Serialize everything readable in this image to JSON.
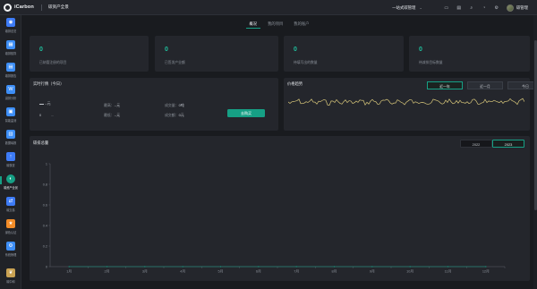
{
  "header": {
    "brand": "iCarbon",
    "section_title": "碳资产全景",
    "org_select": "一站式碳管理",
    "user_name": "碳管理",
    "icons": [
      "monitor-icon",
      "clipboard-icon",
      "search-icon",
      "bell-icon",
      "settings-icon"
    ]
  },
  "sidebar": {
    "items": [
      {
        "label": "碳排总览",
        "color": "#3d7bf6",
        "icon": "globe-icon"
      },
      {
        "label": "碳排核算",
        "color": "#3d8ef6",
        "icon": "calculator-icon"
      },
      {
        "label": "碳排报告",
        "color": "#3d8ef6",
        "icon": "report-icon"
      },
      {
        "label": "减排分析",
        "color": "#3d8ef6",
        "icon": "chart-icon"
      },
      {
        "label": "智能监测",
        "color": "#3d8ef6",
        "icon": "monitor-icon"
      },
      {
        "label": "数据填报",
        "color": "#3d8ef6",
        "icon": "form-icon"
      },
      {
        "label": "碳核查",
        "color": "#3d7bf6",
        "icon": "check-icon"
      },
      {
        "label": "碳资产全景",
        "color": "#16a085",
        "icon": "asset-icon"
      },
      {
        "label": "碳交易",
        "color": "#3d7bf6",
        "icon": "trade-icon"
      },
      {
        "label": "绿色认证",
        "color": "#f28c28",
        "icon": "certificate-icon"
      },
      {
        "label": "系统管理",
        "color": "#3d8ef6",
        "icon": "gear-icon"
      },
      {
        "label": "碳中和",
        "color": "#c9a253",
        "icon": "leaf-icon"
      }
    ]
  },
  "tabs": [
    {
      "label": "概况",
      "active": true
    },
    {
      "label": "我的项目",
      "active": false
    },
    {
      "label": "我的账户",
      "active": false
    }
  ],
  "stats": [
    {
      "value": "0",
      "label": "已纳管注册的项目"
    },
    {
      "value": "0",
      "label": "已签发产业额"
    },
    {
      "value": "0",
      "label": "待填写出的数量"
    },
    {
      "value": "0",
      "label": "待减排目标数量"
    }
  ],
  "realtime": {
    "title": "实时行情（今日）",
    "price_value": "--元",
    "price_change": "0",
    "price_change_dim": "--",
    "high_label": "最高：",
    "high_value": "--元",
    "low_label": "最低：",
    "low_value": "--元",
    "volume_label": "成交量：",
    "volume_value": "0吨",
    "amount_label": "成交额：",
    "amount_value": "0元",
    "button_label": "去购买"
  },
  "trend": {
    "title": "价格趋势",
    "ranges": [
      {
        "label": "近一年",
        "active": true
      },
      {
        "label": "近一月",
        "active": false
      },
      {
        "label": "今日",
        "active": false
      }
    ]
  },
  "yearly": {
    "title": "碳排总量",
    "years": [
      {
        "label": "2022",
        "active": false
      },
      {
        "label": "2023",
        "active": true
      }
    ]
  },
  "chart_data": {
    "type": "line",
    "categories": [
      "1月",
      "2月",
      "3月",
      "4月",
      "5月",
      "6月",
      "7月",
      "8月",
      "9月",
      "10月",
      "11月",
      "12月"
    ],
    "series": [
      {
        "values": [
          0,
          0,
          0,
          0,
          0,
          0,
          0,
          0,
          0,
          0,
          0,
          0
        ]
      }
    ],
    "ylim": [
      0,
      1
    ],
    "yticks": [
      "0",
      "0.2",
      "0.4",
      "0.6",
      "0.8",
      "1"
    ],
    "grid": false
  }
}
